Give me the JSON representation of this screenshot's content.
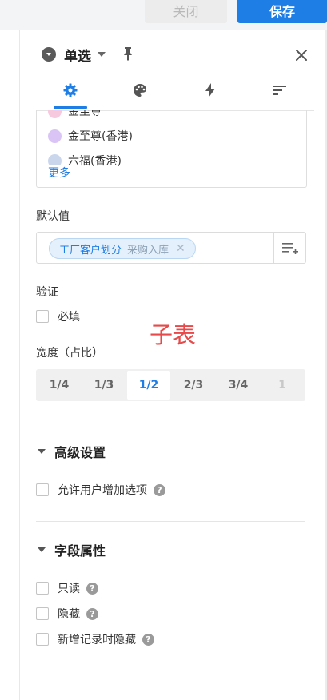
{
  "toolbar": {
    "close_label": "关闭",
    "save_label": "保存"
  },
  "header": {
    "title": "单选"
  },
  "options": {
    "items": [
      {
        "label": "金至尊",
        "color": "#f6c9df"
      },
      {
        "label": "金至尊(香港)",
        "color": "#d9c4f5"
      },
      {
        "label": "六福(香港)",
        "color": "#c9d6ec"
      }
    ],
    "more_label": "更多"
  },
  "default_value": {
    "label": "默认值",
    "tag_main": "工厂客户划分",
    "tag_sub": "采购入库"
  },
  "validation": {
    "label": "验证",
    "required_label": "必填"
  },
  "annotation": "子表",
  "width": {
    "label": "宽度（占比）",
    "options": [
      "1/4",
      "1/3",
      "1/2",
      "2/3",
      "3/4",
      "1"
    ],
    "selected": "1/2"
  },
  "advanced": {
    "title": "高级设置",
    "allow_add_label": "允许用户增加选项"
  },
  "field_props": {
    "title": "字段属性",
    "readonly_label": "只读",
    "hidden_label": "隐藏",
    "hide_on_new_label": "新增记录时隐藏"
  },
  "colors": {
    "accent": "#1f7de6",
    "annotation": "#e64a4a"
  }
}
